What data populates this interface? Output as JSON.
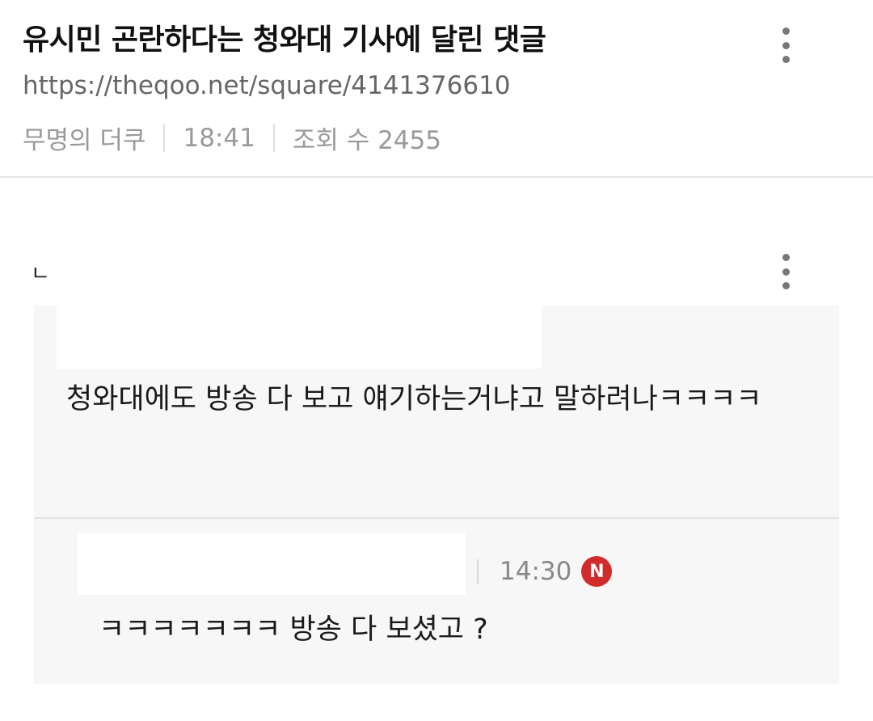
{
  "post": {
    "title": "유시민 곤란하다는 청와대 기사에 달린 댓글",
    "url": "https://theqoo.net/square/4141376610",
    "author": "무명의 더쿠",
    "time": "18:41",
    "views_label": "조회 수 2455"
  },
  "comments": [
    {
      "text": "청와대에도 방송 다 보고 얘기하는거냐고 말하려나ㅋㅋㅋㅋ",
      "menu_icon": "more-vertical-icon"
    },
    {
      "reply_marker": "ㄴ",
      "time": "14:30",
      "badge": "N",
      "text": "ㅋㅋㅋㅋㅋㅋㅋ 방송 다 보셨고 ?",
      "menu_icon": "more-vertical-icon"
    }
  ],
  "colors": {
    "badge": "#d22b2b",
    "comment_bg": "#f7f7f7"
  }
}
